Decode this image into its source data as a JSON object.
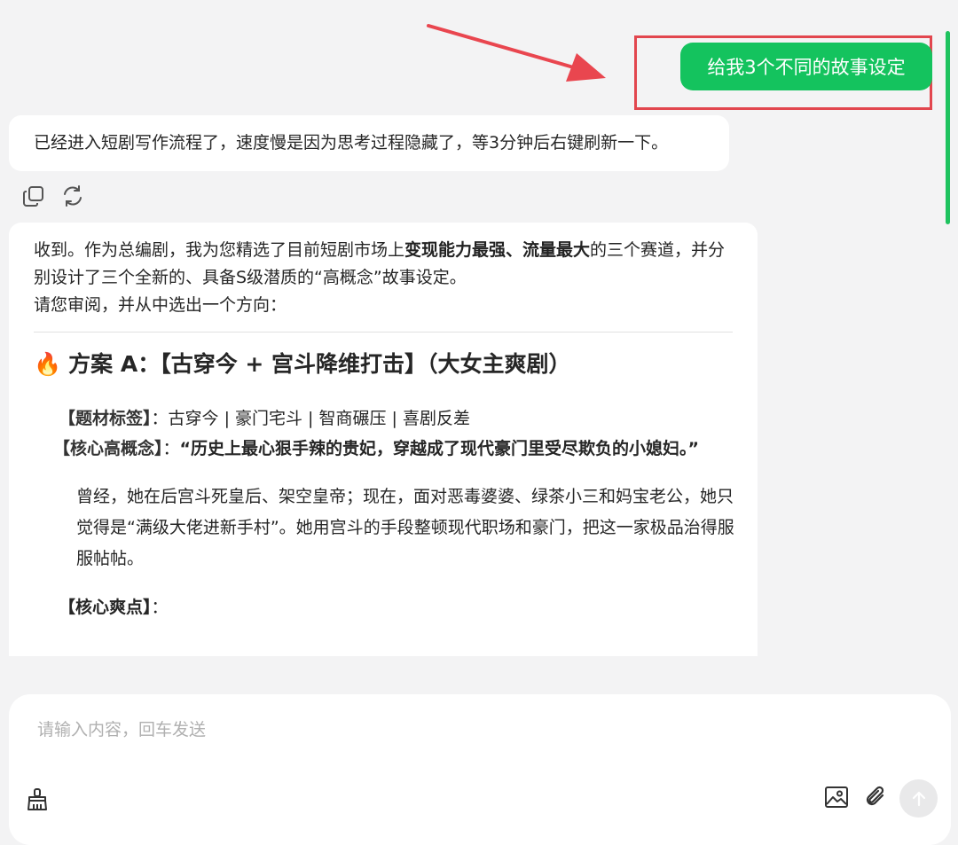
{
  "user_message": "给我3个不同的故事设定",
  "assistant_message_1": "已经进入短剧写作流程了，速度慢是因为思考过程隐藏了，等3分钟后右键刷新一下。",
  "actions": {
    "copy_icon": "copy-icon",
    "regenerate_icon": "refresh-icon"
  },
  "assistant_message_2": {
    "intro_part1": "收到。作为总编剧，我为您精选了目前短剧市场上",
    "intro_bold": "变现能力最强、流量最大",
    "intro_part2": "的三个赛道，并分别设计了三个全新的、具备S级潜质的“高概念”故事设定。",
    "intro_line3": "请您审阅，并从中选出一个方向：",
    "plan_icon": "🔥",
    "plan_title": "方案 A：【古穿今 + 宫斗降维打击】（大女主爽剧）",
    "tags_label": "【题材标签】",
    "tags_colon": "：",
    "tags_value": "古穿今 | 豪门宅斗 | 智商碾压 | 喜剧反差",
    "concept_label": "【核心高概念】",
    "concept_colon": "：",
    "concept_value": "“历史上最心狠手辣的贵妃，穿越成了现代豪门里受尽欺负的小媳妇。”",
    "paragraph": "曾经，她在后宫斗死皇后、架空皇帝；现在，面对恶毒婆婆、绿茶小三和妈宝老公，她只觉得是“满级大佬进新手村”。她用宫斗的手段整顿现代职场和豪门，把这一家极品治得服服帖帖。",
    "core_label": "【核心爽点】",
    "core_colon": "："
  },
  "input": {
    "placeholder": "请输入内容，回车发送"
  },
  "colors": {
    "user_bubble": "#14c35e",
    "highlight": "#e2464e",
    "scrollbar": "#1fc35f"
  }
}
